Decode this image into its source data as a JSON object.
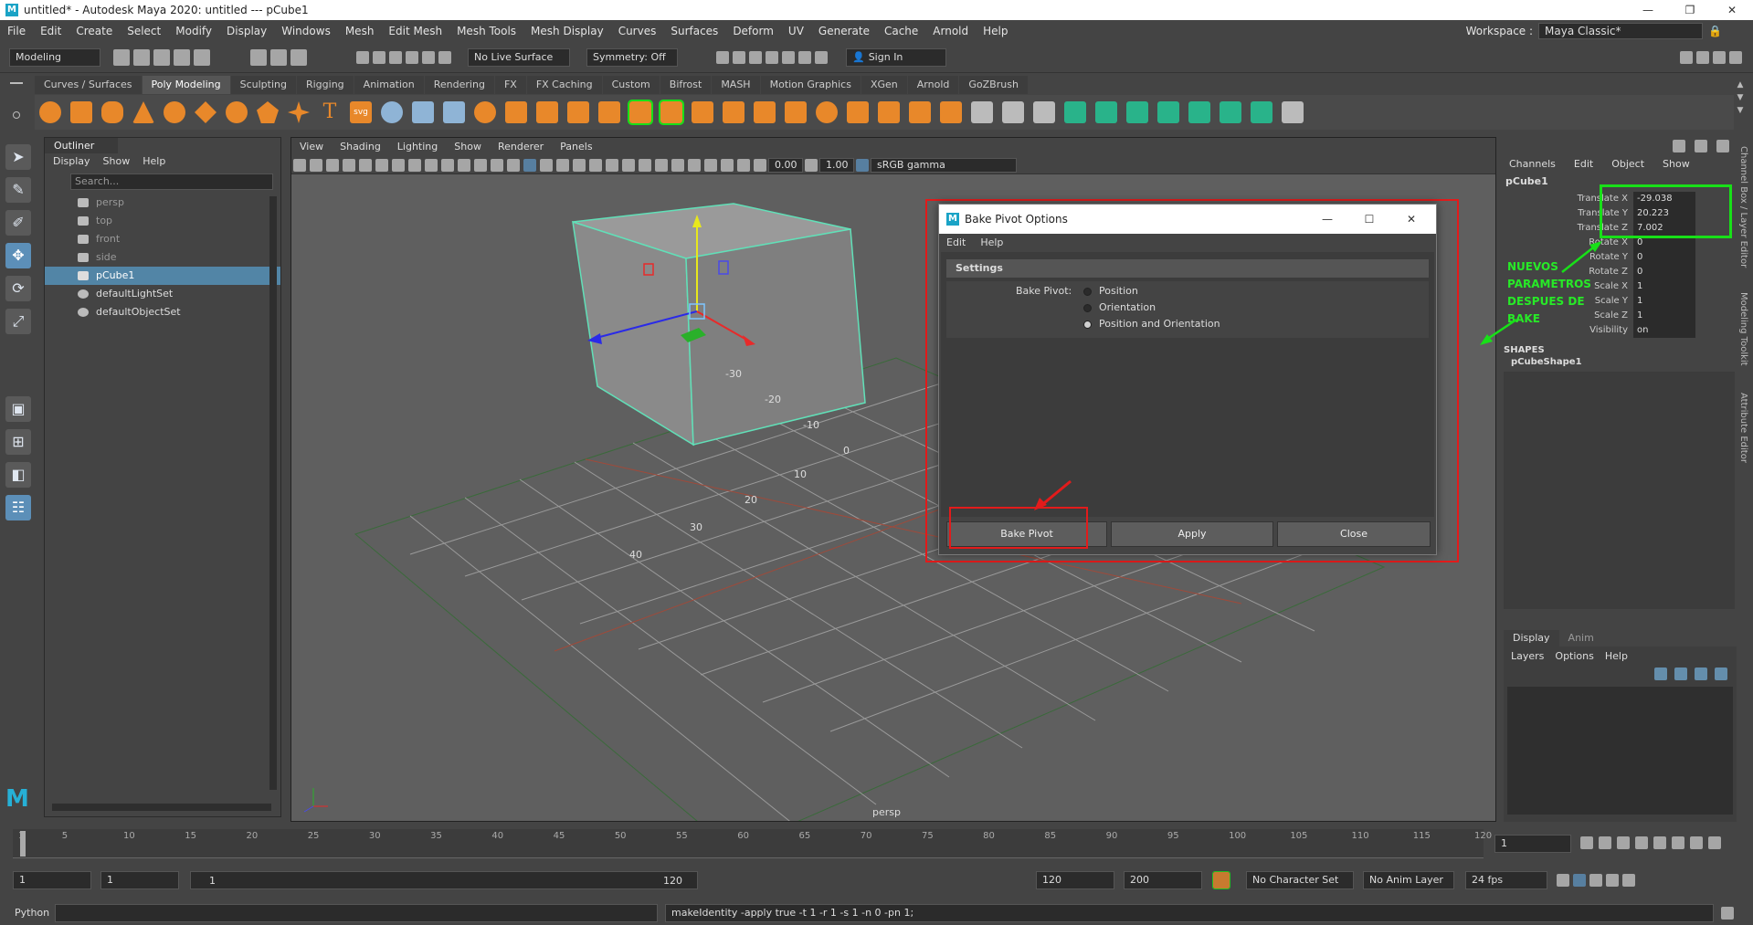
{
  "window": {
    "title": "untitled* - Autodesk Maya 2020: untitled  ---  pCube1",
    "logo": "M",
    "min": "—",
    "max": "❐",
    "close": "✕"
  },
  "menubar": {
    "items": [
      "File",
      "Edit",
      "Create",
      "Select",
      "Modify",
      "Display",
      "Windows",
      "Mesh",
      "Edit Mesh",
      "Mesh Tools",
      "Mesh Display",
      "Curves",
      "Surfaces",
      "Deform",
      "UV",
      "Generate",
      "Cache",
      "Arnold",
      "Help"
    ],
    "workspace_label": "Workspace :",
    "workspace_value": "Maya Classic*"
  },
  "status_line": {
    "menuset": "Modeling",
    "live_surface": "No Live Surface",
    "symmetry": "Symmetry: Off",
    "sign_in": "Sign In"
  },
  "shelf": {
    "tabs": [
      "Curves / Surfaces",
      "Poly Modeling",
      "Sculpting",
      "Rigging",
      "Animation",
      "Rendering",
      "FX",
      "FX Caching",
      "Custom",
      "Bifrost",
      "MASH",
      "Motion Graphics",
      "XGen",
      "Arnold",
      "GoZBrush"
    ],
    "active_tab": "Poly Modeling",
    "icon_text_t": "T",
    "icon_text_svg": "svg"
  },
  "outliner": {
    "tab": "Outliner",
    "menu": [
      "Display",
      "Show",
      "Help"
    ],
    "search_placeholder": "Search...",
    "items": [
      "persp",
      "top",
      "front",
      "side",
      "pCube1",
      "defaultLightSet",
      "defaultObjectSet"
    ]
  },
  "viewport": {
    "menu": [
      "View",
      "Shading",
      "Lighting",
      "Show",
      "Renderer",
      "Panels"
    ],
    "field1": "0.00",
    "field2": "1.00",
    "colorspace": "sRGB gamma",
    "camera_label": "persp",
    "grid_labels": [
      "-30",
      "-20",
      "-10",
      "0",
      "10",
      "20",
      "30",
      "40",
      "30",
      "40"
    ]
  },
  "dialog": {
    "title": "Bake Pivot Options",
    "logo": "M",
    "menu": [
      "Edit",
      "Help"
    ],
    "section": "Settings",
    "field_label": "Bake Pivot:",
    "options": [
      "Position",
      "Orientation",
      "Position and Orientation"
    ],
    "selected": "Position and Orientation",
    "buttons": {
      "bake": "Bake Pivot",
      "apply": "Apply",
      "close": "Close"
    }
  },
  "channel_box": {
    "menu": [
      "Channels",
      "Edit",
      "Object",
      "Show"
    ],
    "object": "pCube1",
    "channels": [
      {
        "label": "Translate X",
        "value": "-29.038"
      },
      {
        "label": "Translate Y",
        "value": "20.223"
      },
      {
        "label": "Translate Z",
        "value": "7.002"
      },
      {
        "label": "Rotate X",
        "value": "0"
      },
      {
        "label": "Rotate Y",
        "value": "0"
      },
      {
        "label": "Rotate Z",
        "value": "0"
      },
      {
        "label": "Scale X",
        "value": "1"
      },
      {
        "label": "Scale Y",
        "value": "1"
      },
      {
        "label": "Scale Z",
        "value": "1"
      },
      {
        "label": "Visibility",
        "value": "on"
      }
    ],
    "shapes_header": "SHAPES",
    "shape": "pCubeShape1"
  },
  "annotation": {
    "lines": [
      "NUEVOS",
      "PARAMETROS",
      "DESPUES DE",
      "BAKE"
    ]
  },
  "layer_editor": {
    "tabs": [
      "Display",
      "Anim"
    ],
    "menu": [
      "Layers",
      "Options",
      "Help"
    ]
  },
  "side_tabs": [
    "Channel Box / Layer Editor",
    "Modeling Toolkit",
    "Attribute Editor"
  ],
  "timeline": {
    "ticks": [
      "5",
      "10",
      "15",
      "20",
      "25",
      "30",
      "35",
      "40",
      "45",
      "50",
      "55",
      "60",
      "65",
      "70",
      "75",
      "80",
      "85",
      "90",
      "95",
      "100",
      "105",
      "110",
      "115",
      "120"
    ],
    "start_label": "1",
    "current_frame": "1"
  },
  "range": {
    "start": "1",
    "inner_start": "1",
    "slider_start": "1",
    "slider_end": "120",
    "end": "120",
    "outer_end": "200",
    "character_set": "No Character Set",
    "anim_layer": "No Anim Layer",
    "fps": "24 fps"
  },
  "command": {
    "lang": "Python",
    "result": "makeIdentity -apply true -t 1 -r 1 -s 1 -n 0 -pn 1;"
  },
  "colors": {
    "accent_selection": "#5285a6",
    "annotation_red": "#e21b1b",
    "annotation_green": "#18e018"
  }
}
